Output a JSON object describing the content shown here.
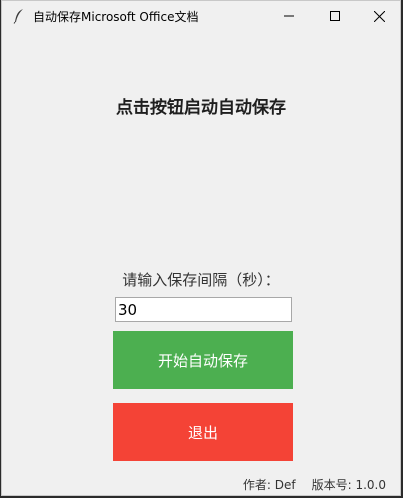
{
  "window": {
    "title": "自动保存Microsoft Office文档",
    "app_icon": "feather-icon",
    "controls": [
      "minimize-icon",
      "maximize-icon",
      "close-icon"
    ]
  },
  "main": {
    "heading": "点击按钮启动自动保存",
    "interval_label": "请输入保存间隔（秒）：",
    "interval_value": "30",
    "start_button": "开始自动保存",
    "exit_button": "退出"
  },
  "footer": {
    "author": "作者: Def",
    "version": "版本号: 1.0.0"
  },
  "colors": {
    "start_button": "#4caf50",
    "exit_button": "#f44336",
    "background": "#f0f0f0"
  }
}
